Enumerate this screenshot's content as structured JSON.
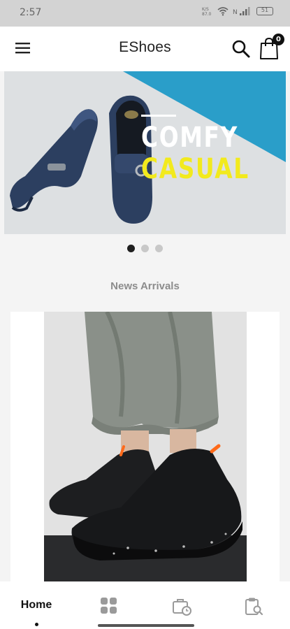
{
  "status_bar": {
    "time": "2:57",
    "battery": "51",
    "icons": [
      "data-speed-icon",
      "wifi-icon",
      "signal-icon",
      "battery-icon"
    ]
  },
  "app_bar": {
    "title": "EShoes",
    "cart_count": "0",
    "icons": [
      "menu-icon",
      "search-icon",
      "shopping-bag-icon"
    ]
  },
  "banner": {
    "line1": "COMFY",
    "line2": "CASUAL",
    "accent_color": "#2a9ec9",
    "line2_color": "#f2ea1d",
    "slides": 3,
    "active_slide": 1
  },
  "section": {
    "title": "News Arrivals"
  },
  "bottom_nav": {
    "items": [
      {
        "label": "Home",
        "icon": "home",
        "active": true
      },
      {
        "label": "",
        "icon": "grid-icon"
      },
      {
        "label": "",
        "icon": "briefcase-clock-icon"
      },
      {
        "label": "",
        "icon": "clipboard-search-icon"
      }
    ]
  }
}
